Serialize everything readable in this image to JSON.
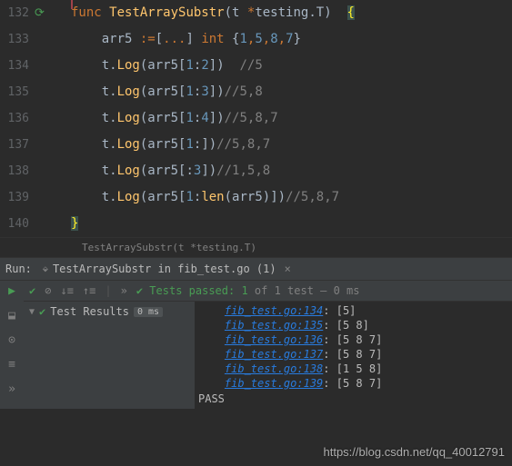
{
  "lines": [
    {
      "n": "132",
      "indent": "",
      "tokens": [
        {
          "t": "func ",
          "c": "kw"
        },
        {
          "t": "TestArraySubstr",
          "c": "func"
        },
        {
          "t": "(",
          "c": "paren"
        },
        {
          "t": "t ",
          "c": ""
        },
        {
          "t": "*",
          "c": "kw"
        },
        {
          "t": "testing",
          "c": ""
        },
        {
          "t": ".",
          "c": ""
        },
        {
          "t": "T",
          "c": ""
        },
        {
          "t": ")  ",
          "c": ""
        },
        {
          "t": "{",
          "c": "brace-hl"
        }
      ]
    },
    {
      "n": "133",
      "indent": "    ",
      "tokens": [
        {
          "t": "arr5 ",
          "c": ""
        },
        {
          "t": ":=",
          "c": "kw"
        },
        {
          "t": "[",
          "c": ""
        },
        {
          "t": "...",
          "c": "kw"
        },
        {
          "t": "] ",
          "c": ""
        },
        {
          "t": "int ",
          "c": "kw"
        },
        {
          "t": "{",
          "c": ""
        },
        {
          "t": "1",
          "c": "num"
        },
        {
          "t": ",",
          "c": "kw"
        },
        {
          "t": "5",
          "c": "num"
        },
        {
          "t": ",",
          "c": "kw"
        },
        {
          "t": "8",
          "c": "num"
        },
        {
          "t": ",",
          "c": "kw"
        },
        {
          "t": "7",
          "c": "num"
        },
        {
          "t": "}",
          "c": ""
        }
      ]
    },
    {
      "n": "134",
      "indent": "    ",
      "tokens": [
        {
          "t": "t.",
          "c": ""
        },
        {
          "t": "Log",
          "c": "func"
        },
        {
          "t": "(arr5[",
          "c": ""
        },
        {
          "t": "1",
          "c": "num"
        },
        {
          "t": ":",
          "c": ""
        },
        {
          "t": "2",
          "c": "num"
        },
        {
          "t": "])  ",
          "c": ""
        },
        {
          "t": "//5",
          "c": "comment"
        }
      ]
    },
    {
      "n": "135",
      "indent": "    ",
      "tokens": [
        {
          "t": "t.",
          "c": ""
        },
        {
          "t": "Log",
          "c": "func"
        },
        {
          "t": "(arr5[",
          "c": ""
        },
        {
          "t": "1",
          "c": "num"
        },
        {
          "t": ":",
          "c": ""
        },
        {
          "t": "3",
          "c": "num"
        },
        {
          "t": "])",
          "c": ""
        },
        {
          "t": "//5,8",
          "c": "comment"
        }
      ]
    },
    {
      "n": "136",
      "indent": "    ",
      "tokens": [
        {
          "t": "t.",
          "c": ""
        },
        {
          "t": "Log",
          "c": "func"
        },
        {
          "t": "(arr5[",
          "c": ""
        },
        {
          "t": "1",
          "c": "num"
        },
        {
          "t": ":",
          "c": ""
        },
        {
          "t": "4",
          "c": "num"
        },
        {
          "t": "])",
          "c": ""
        },
        {
          "t": "//5,8,7",
          "c": "comment"
        }
      ]
    },
    {
      "n": "137",
      "indent": "    ",
      "tokens": [
        {
          "t": "t.",
          "c": ""
        },
        {
          "t": "Log",
          "c": "func"
        },
        {
          "t": "(arr5[",
          "c": ""
        },
        {
          "t": "1",
          "c": "num"
        },
        {
          "t": ":])",
          "c": ""
        },
        {
          "t": "//5,8,7",
          "c": "comment"
        }
      ]
    },
    {
      "n": "138",
      "indent": "    ",
      "tokens": [
        {
          "t": "t.",
          "c": ""
        },
        {
          "t": "Log",
          "c": "func"
        },
        {
          "t": "(arr5[:",
          "c": ""
        },
        {
          "t": "3",
          "c": "num"
        },
        {
          "t": "])",
          "c": ""
        },
        {
          "t": "//1,5,8",
          "c": "comment"
        }
      ]
    },
    {
      "n": "139",
      "indent": "    ",
      "tokens": [
        {
          "t": "t.",
          "c": ""
        },
        {
          "t": "Log",
          "c": "func"
        },
        {
          "t": "(arr5[",
          "c": ""
        },
        {
          "t": "1",
          "c": "num"
        },
        {
          "t": ":",
          "c": ""
        },
        {
          "t": "len",
          "c": "func"
        },
        {
          "t": "(arr5)])",
          "c": ""
        },
        {
          "t": "//5,8,7",
          "c": "comment"
        }
      ]
    },
    {
      "n": "140",
      "indent": "",
      "tokens": [
        {
          "t": "}",
          "c": "brace-hl"
        }
      ]
    }
  ],
  "breadcrumb": "TestArraySubstr(t *testing.T)",
  "runLabel": "Run:",
  "runTab": "TestArraySubstr in fib_test.go (1)",
  "passed": "Tests passed: 1",
  "passedOf": " of 1 test – 0 ms",
  "treeLabel": "Test Results",
  "treeMs": "0 ms",
  "output": [
    {
      "link": "fib_test.go:134",
      "txt": ": [5]"
    },
    {
      "link": "fib_test.go:135",
      "txt": ": [5 8]"
    },
    {
      "link": "fib_test.go:136",
      "txt": ": [5 8 7]"
    },
    {
      "link": "fib_test.go:137",
      "txt": ": [5 8 7]"
    },
    {
      "link": "fib_test.go:138",
      "txt": ": [1 5 8]"
    },
    {
      "link": "fib_test.go:139",
      "txt": ": [5 8 7]"
    }
  ],
  "pass": "PASS",
  "watermark": "https://blog.csdn.net/qq_40012791"
}
